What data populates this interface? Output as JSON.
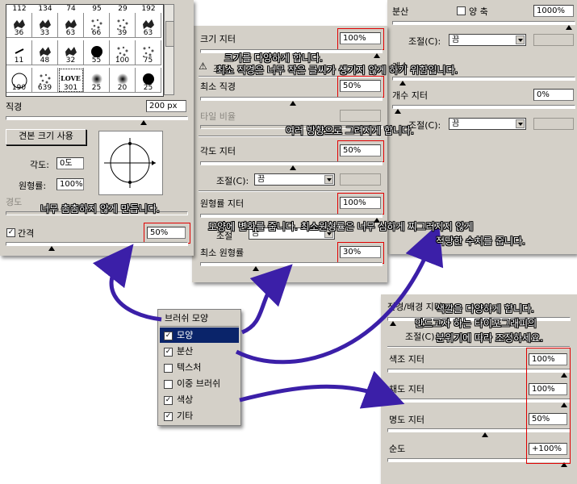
{
  "colors": {
    "panel": "#d4d0c8",
    "highlight": "#e00000",
    "arrow": "#3b1fa8",
    "selected": "#0a246a"
  },
  "brush_panel": {
    "header_numbers": [
      "112",
      "134",
      "74",
      "95",
      "29",
      "192"
    ],
    "brushes": [
      {
        "num": "36",
        "shape": "splat"
      },
      {
        "num": "33",
        "shape": "splat"
      },
      {
        "num": "63",
        "shape": "splat"
      },
      {
        "num": "66",
        "shape": "dots"
      },
      {
        "num": "39",
        "shape": "dots"
      },
      {
        "num": "63",
        "shape": "splat"
      },
      {
        "num": "11",
        "shape": "leaf"
      },
      {
        "num": "48",
        "shape": "splat"
      },
      {
        "num": "32",
        "shape": "splat"
      },
      {
        "num": "55",
        "shape": "solid"
      },
      {
        "num": "100",
        "shape": "dots"
      },
      {
        "num": "75",
        "shape": "dots"
      },
      {
        "num": "190",
        "shape": "circle"
      },
      {
        "num": "639",
        "shape": "dots"
      },
      {
        "num": "301",
        "shape": "love"
      },
      {
        "num": "25",
        "shape": "soft"
      },
      {
        "num": "20",
        "shape": "soft"
      },
      {
        "num": "25",
        "shape": "solid"
      }
    ],
    "love_text": "LOVE",
    "diameter_label": "직경",
    "diameter_value": "200 px",
    "sample_size_button": "견본 크기 사용",
    "angle_label": "각도:",
    "angle_value": "0도",
    "roundness_label": "원형률:",
    "roundness_value": "100%",
    "hardness_label": "경도",
    "spacing_label": "간격",
    "spacing_checked": "✓",
    "spacing_value": "50%"
  },
  "shape_panel": {
    "size_jitter_label": "크기 지터",
    "size_jitter_value": "100%",
    "control_label": "조절",
    "warning_icon": "⚠",
    "min_diameter_label": "최소 직경",
    "min_diameter_value": "50%",
    "tilt_scale_label": "타일 비율",
    "angle_jitter_label": "각도 지터",
    "angle_jitter_value": "50%",
    "control2_label": "조절(C):",
    "control2_value": "끔",
    "roundness_jitter_label": "원형률 지터",
    "roundness_jitter_value": "100%",
    "control3_label": "조절",
    "control3_value": "끔",
    "min_roundness_label": "최소 원형률",
    "min_roundness_value": "30%"
  },
  "scatter_panel": {
    "scatter_label": "분산",
    "both_axes_label": "양 축",
    "scatter_value": "1000%",
    "control_label": "조절(C):",
    "control_value": "끔",
    "count_label": "개수",
    "count_jitter_label": "개수 지터",
    "count_jitter_value": "0%",
    "control2_label": "조절(C):",
    "control2_value": "끔"
  },
  "menu": {
    "title": "브러쉬 모양",
    "items": [
      {
        "label": "모양",
        "check": "✓",
        "selected": true
      },
      {
        "label": "분산",
        "check": "✓",
        "selected": false
      },
      {
        "label": "텍스처",
        "check": "",
        "selected": false
      },
      {
        "label": "이중 브러쉬",
        "check": "",
        "selected": false
      },
      {
        "label": "색상",
        "check": "✓",
        "selected": false
      },
      {
        "label": "기타",
        "check": "✓",
        "selected": false
      }
    ]
  },
  "color_panel": {
    "fg_bg_label": "전경/배경 지터",
    "control_label": "조절(C):",
    "hue_jitter_label": "색조 지터",
    "hue_jitter_value": "100%",
    "sat_jitter_label": "채도 지터",
    "sat_jitter_value": "100%",
    "bright_jitter_label": "명도 지터",
    "bright_jitter_value": "50%",
    "purity_label": "순도",
    "purity_value": "+100%"
  },
  "annotations": {
    "size_note": "크기를 다양하게 합니다.",
    "min_note": "최소 직경은 너무 작은 글씨가 생기지 않게 하기 위함입니다.",
    "angle_note": "여러 방향으로 그려지게 합니다.",
    "spacing_note": "너무 촘촘하지 않게 만듭니다.",
    "round_note1": "모양에 변화를 줍니다. 최소원형률은 너무 심하게 찌그러지지 않게",
    "round_note2": "적당한 수치를 줍니다.",
    "color_note1": "색깔을 다양하게 합니다.",
    "color_note2": "만드고자 하는 타이포그래피의",
    "color_note3": "분위기에 따라 조정하세요."
  }
}
